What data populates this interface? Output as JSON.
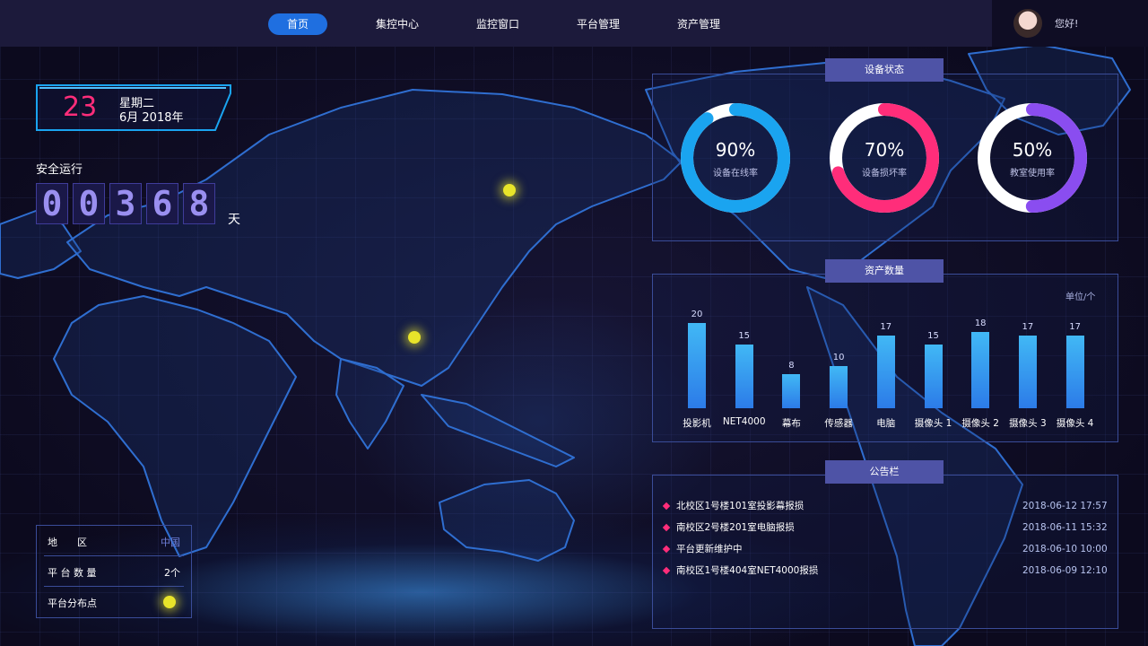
{
  "nav": {
    "items": [
      "首页",
      "集控中心",
      "监控窗口",
      "平台管理",
      "资产管理"
    ],
    "active": "首页"
  },
  "user": {
    "greeting": "您好!"
  },
  "date": {
    "day": "23",
    "weekday": "星期二",
    "month_year": "6月 2018年"
  },
  "safety": {
    "title": "安全运行",
    "digits": [
      "0",
      "0",
      "3",
      "6",
      "8"
    ],
    "unit": "天"
  },
  "device_status": {
    "title": "设备状态",
    "rings": [
      {
        "percent_label": "90%",
        "label": "设备在线率",
        "value": 0.9,
        "color": "#1aa4f0"
      },
      {
        "percent_label": "70%",
        "label": "设备损坏率",
        "value": 0.7,
        "color": "#ff2d7a"
      },
      {
        "percent_label": "50%",
        "label": "教室使用率",
        "value": 0.5,
        "color": "#8a4df0"
      }
    ]
  },
  "assets": {
    "title": "资产数量",
    "unit": "单位/个"
  },
  "chart_data": {
    "type": "bar",
    "categories": [
      "投影机",
      "NET4000",
      "幕布",
      "传感器",
      "电脑",
      "摄像头 1",
      "摄像头 2",
      "摄像头 3",
      "摄像头 4"
    ],
    "values": [
      20,
      15,
      8,
      10,
      17,
      15,
      18,
      17,
      17
    ],
    "ylim": [
      0,
      20
    ],
    "grid": false
  },
  "notices": {
    "title": "公告栏",
    "items": [
      {
        "text": "北校区1号楼101室投影幕报损",
        "time": "2018-06-12 17:57"
      },
      {
        "text": "南校区2号楼201室电脑报损",
        "time": "2018-06-11 15:32"
      },
      {
        "text": "平台更新维护中",
        "time": "2018-06-10 10:00"
      },
      {
        "text": "南校区1号楼404室NET4000报损",
        "time": "2018-06-09 12:10"
      }
    ]
  },
  "info": {
    "region_label": "地　　区",
    "region_value": "中国",
    "count_label": "平 台 数 量",
    "count_value": "2个",
    "point_label": "平台分布点"
  }
}
